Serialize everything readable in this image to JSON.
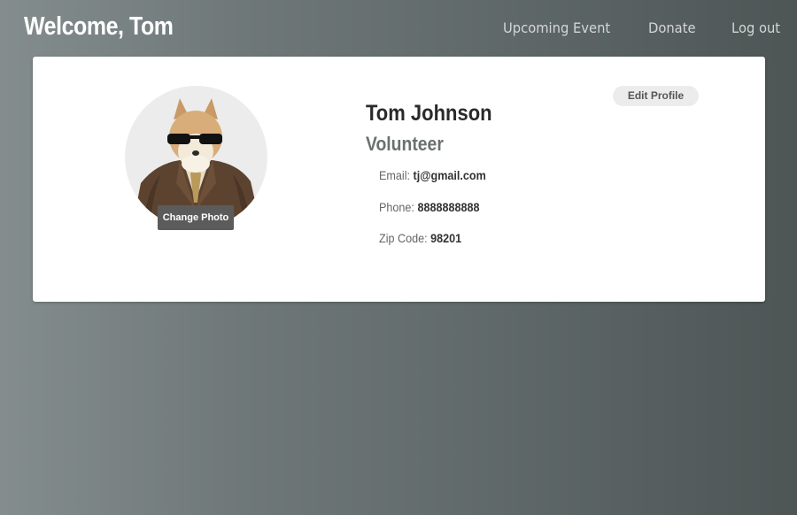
{
  "header": {
    "welcome": "Welcome, Tom",
    "nav": {
      "upcoming_event": "Upcoming Event",
      "donate": "Donate",
      "log_out": "Log out"
    }
  },
  "profile": {
    "name": "Tom Johnson",
    "role": "Volunteer",
    "edit_button": "Edit Profile",
    "change_photo_button": "Change Photo",
    "avatar_icon": "dog-in-suit-avatar",
    "email_label": "Email:",
    "email_value": "tj@gmail.com",
    "phone_label": "Phone:",
    "phone_value": "8888888888",
    "zip_label": "Zip Code:",
    "zip_value": "98201"
  },
  "colors": {
    "background_light": "#848d8d",
    "background_dark": "#4d5555",
    "card": "#ffffff",
    "role_text": "#6b7070"
  }
}
